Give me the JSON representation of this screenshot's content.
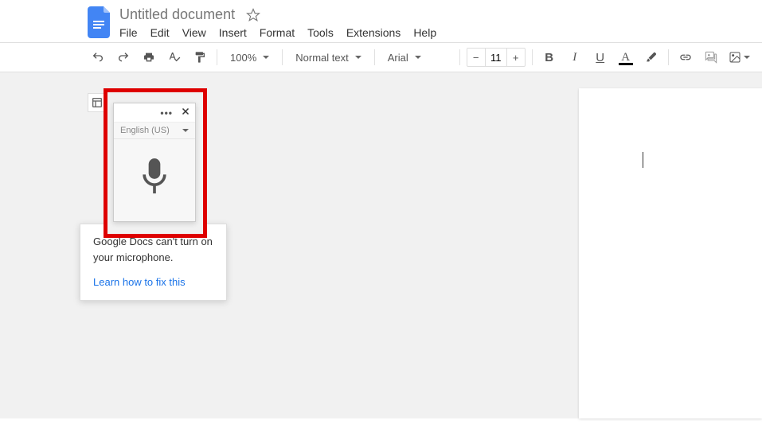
{
  "header": {
    "title": "Untitled document"
  },
  "menu": {
    "items": [
      "File",
      "Edit",
      "View",
      "Insert",
      "Format",
      "Tools",
      "Extensions",
      "Help"
    ]
  },
  "toolbar": {
    "zoom": "100%",
    "style": "Normal text",
    "font": "Arial",
    "fontsize": "11",
    "bold": "B",
    "italic": "I",
    "underline": "U",
    "textcolor_letter": "A"
  },
  "voice": {
    "more": "•••",
    "close": "✕",
    "language": "English (US)"
  },
  "error": {
    "message": "Google Docs can't turn on your microphone.",
    "link": "Learn how to fix this"
  }
}
